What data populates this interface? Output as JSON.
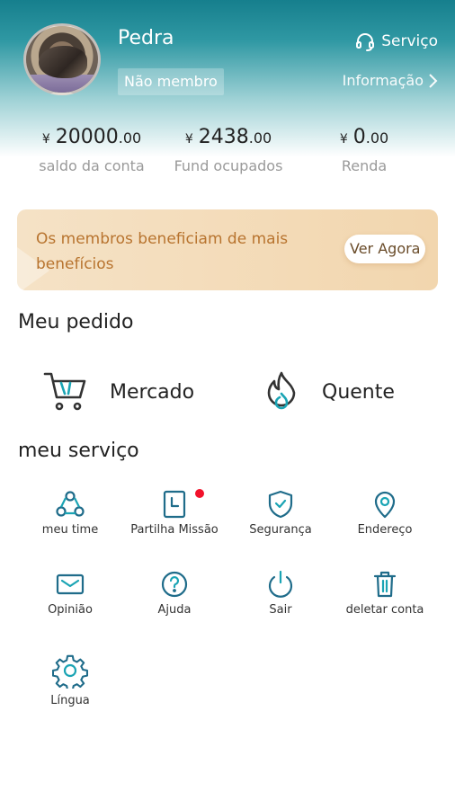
{
  "profile": {
    "name": "Pedra",
    "member_status": "Não membro",
    "service_label": "Serviço",
    "info_label": "Informação"
  },
  "stats": [
    {
      "currency": "¥",
      "integer": "20000",
      "decimal": ".00",
      "label": "saldo da conta"
    },
    {
      "currency": "¥",
      "integer": "2438",
      "decimal": ".00",
      "label": "Fund ocupados"
    },
    {
      "currency": "¥",
      "integer": "0",
      "decimal": ".00",
      "label": "Renda"
    }
  ],
  "promo": {
    "text": "Os membros beneficiam de mais benefícios",
    "button": "Ver Agora"
  },
  "orders": {
    "title": "Meu pedido",
    "items": [
      {
        "label": "Mercado",
        "icon": "cart-icon"
      },
      {
        "label": "Quente",
        "icon": "flame-icon"
      }
    ]
  },
  "services": {
    "title": "meu serviço",
    "items": [
      {
        "label": "meu time",
        "icon": "team-icon"
      },
      {
        "label": "Partilha Missão",
        "icon": "share-task-icon"
      },
      {
        "label": "Segurança",
        "icon": "shield-icon"
      },
      {
        "label": "Endereço",
        "icon": "location-icon"
      },
      {
        "label": "Opinião",
        "icon": "mail-icon"
      },
      {
        "label": "Ajuda",
        "icon": "help-icon"
      },
      {
        "label": "Sair",
        "icon": "power-icon"
      },
      {
        "label": "deletar conta",
        "icon": "trash-icon"
      },
      {
        "label": "Língua",
        "icon": "gear-icon"
      }
    ]
  },
  "colors": {
    "accent": "#167f8d",
    "promo_text": "#b8742f",
    "notification_dot": "#f2122b"
  }
}
